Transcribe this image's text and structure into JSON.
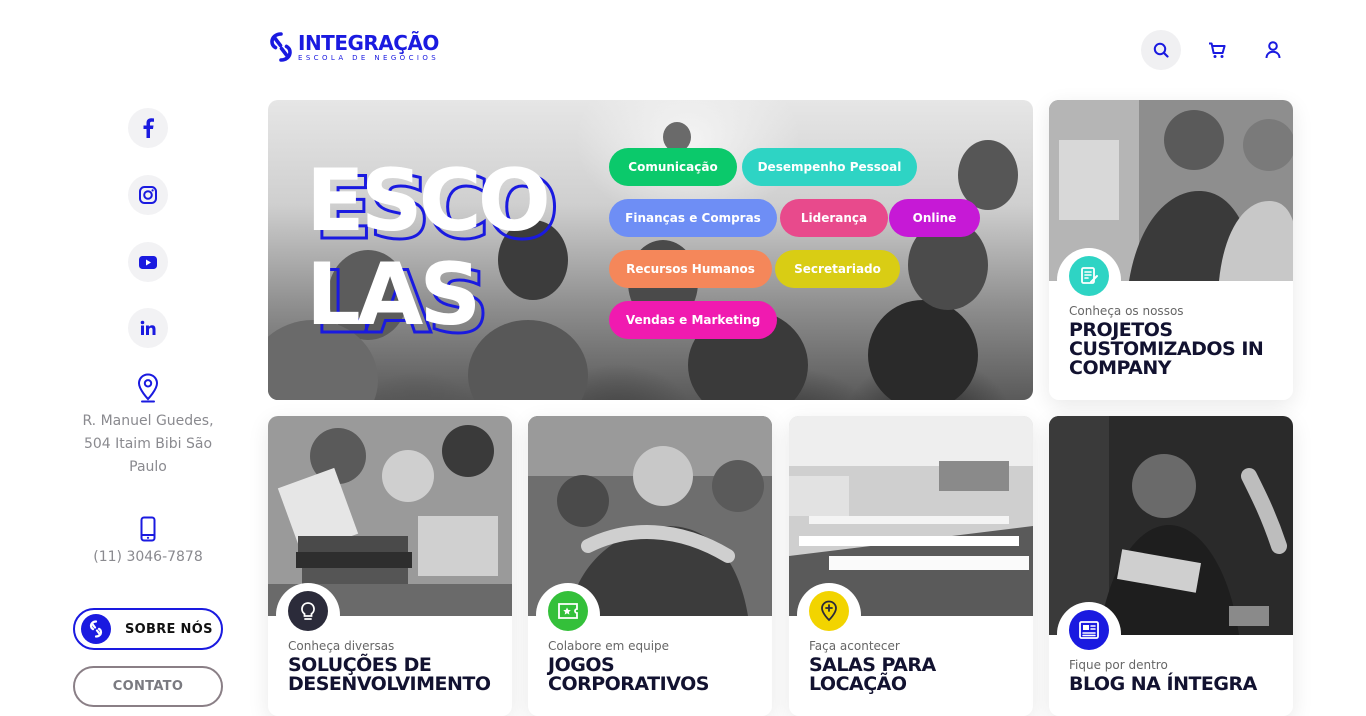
{
  "brand": {
    "title": "INTEGRAÇÃO",
    "subtitle": "ESCOLA DE NEGÓCIOS",
    "color": "#1a1ae0"
  },
  "header": {
    "icons": [
      "search-icon",
      "cart-icon",
      "user-icon"
    ]
  },
  "sidebar": {
    "social": [
      "facebook-icon",
      "instagram-icon",
      "youtube-icon",
      "linkedin-icon"
    ],
    "address": "R. Manuel Guedes, 504 Itaim Bibi São Paulo",
    "phone": "(11) 3046-7878",
    "about_label": "SOBRE NÓS",
    "contact_label": "CONTATO"
  },
  "hero": {
    "word_line1": "ESCO",
    "word_line2": "LAS",
    "chips": [
      {
        "label": "Comunicação",
        "color": "#0bc96b"
      },
      {
        "label": "Desempenho Pessoal",
        "color": "#2ed4c4"
      },
      {
        "label": "Finanças e Compras",
        "color": "#6e8ef5"
      },
      {
        "label": "Liderança",
        "color": "#e84a8c"
      },
      {
        "label": "Online",
        "color": "#c619d6"
      },
      {
        "label": "Recursos Humanos",
        "color": "#f5875a"
      },
      {
        "label": "Secretariado",
        "color": "#d9cd14"
      },
      {
        "label": "Vendas e Marketing",
        "color": "#f01ab0"
      }
    ]
  },
  "cards": {
    "incompany": {
      "pre": "Conheça os nossos",
      "title": "PROJETOS CUSTOMIZADOS IN COMPANY",
      "icon": "handshake-contract-icon",
      "icon_color": "#2ed4c4"
    },
    "solucoes": {
      "pre": "Conheça diversas",
      "title": "SOLUÇÕES DE DESENVOLVIMENTO",
      "icon": "lightbulb-icon",
      "icon_color": "#2b2b3a"
    },
    "jogos": {
      "pre": "Colabore em equipe",
      "title": "JOGOS CORPORATIVOS",
      "icon": "ticket-star-icon",
      "icon_color": "#34c03a"
    },
    "salas": {
      "pre": "Faça acontecer",
      "title": "SALAS PARA LOCAÇÃO",
      "icon": "location-pin-icon",
      "icon_color": "#f2d400"
    },
    "blog": {
      "pre": "Fique por dentro",
      "title": "BLOG NA ÍNTEGRA",
      "icon": "newspaper-icon",
      "icon_color": "#1a1ae0"
    }
  }
}
